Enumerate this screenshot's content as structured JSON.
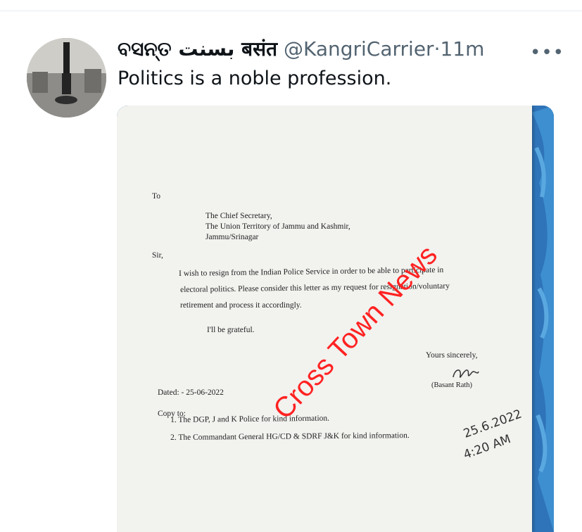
{
  "tweet": {
    "display_name": "ବସନ୍ତ بسنت बसंत",
    "handle": "@KangriCarrier",
    "separator": "·",
    "time": "11m",
    "more_label": "•••",
    "text": "Politics is a noble profession."
  },
  "media": {
    "letter": {
      "to": "To",
      "recipient_lines": [
        "The Chief Secretary,",
        "The Union Territory of Jammu and Kashmir,",
        "Jammu/Srinagar"
      ],
      "salutation": "Sir,",
      "body_lines": [
        "I wish to resign from the Indian Police Service in order to be able to participate in",
        "electoral politics. Please consider this letter as my request for resignation/voluntary",
        "retirement and process it accordingly."
      ],
      "grateful": "I'll be grateful.",
      "closing": "Yours sincerely,",
      "signature_name": "(Basant Rath)",
      "dated": "Dated: - 25-06-2022",
      "copy_to": "Copy to:",
      "copies": [
        "1.   The DGP, J and K Police for kind information.",
        "2.   The Commandant General HG/CD & SDRF J&K for kind information."
      ],
      "handwritten_date": "25.6.2022",
      "handwritten_time": "4:20 AM"
    },
    "watermark": "Cross Town News"
  }
}
